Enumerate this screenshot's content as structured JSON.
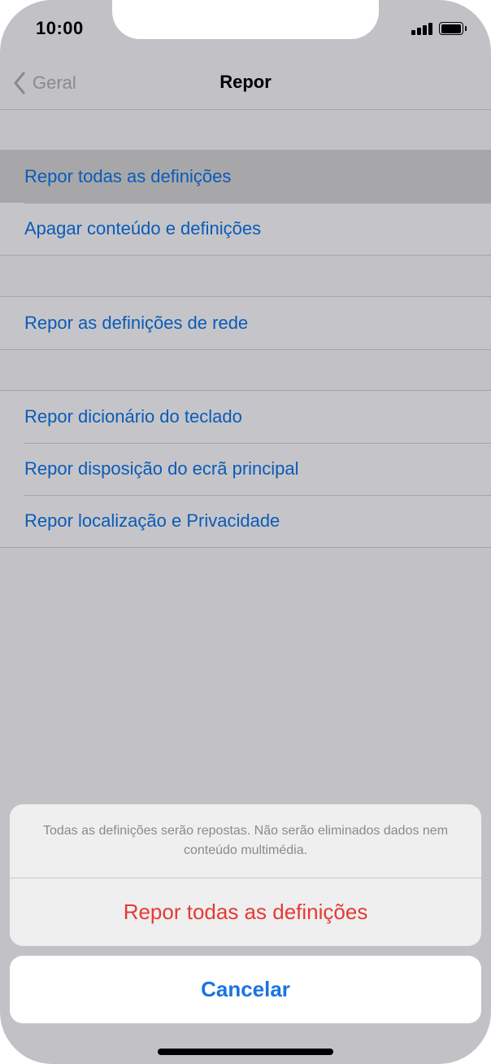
{
  "status_bar": {
    "time": "10:00"
  },
  "nav": {
    "back_label": "Geral",
    "title": "Repor"
  },
  "groups": [
    {
      "items": [
        {
          "label": "Repor todas as definições"
        },
        {
          "label": "Apagar conteúdo e definições"
        }
      ]
    },
    {
      "items": [
        {
          "label": "Repor as definições de rede"
        }
      ]
    },
    {
      "items": [
        {
          "label": "Repor dicionário do teclado"
        },
        {
          "label": "Repor disposição do ecrã principal"
        },
        {
          "label": "Repor localização e Privacidade"
        }
      ]
    }
  ],
  "action_sheet": {
    "message": "Todas as definições serão repostas. Não serão eliminados dados nem conteúdo multimédia.",
    "action_label": "Repor todas as definições",
    "cancel_label": "Cancelar"
  },
  "colors": {
    "link_blue": "#0a5bb8",
    "destructive_red": "#e53a33",
    "cancel_blue": "#1a74e0",
    "dim_background": "#c2c2c6"
  },
  "icons": {
    "back": "chevron-left-icon",
    "signal": "cellular-signal-icon",
    "battery": "battery-icon"
  }
}
